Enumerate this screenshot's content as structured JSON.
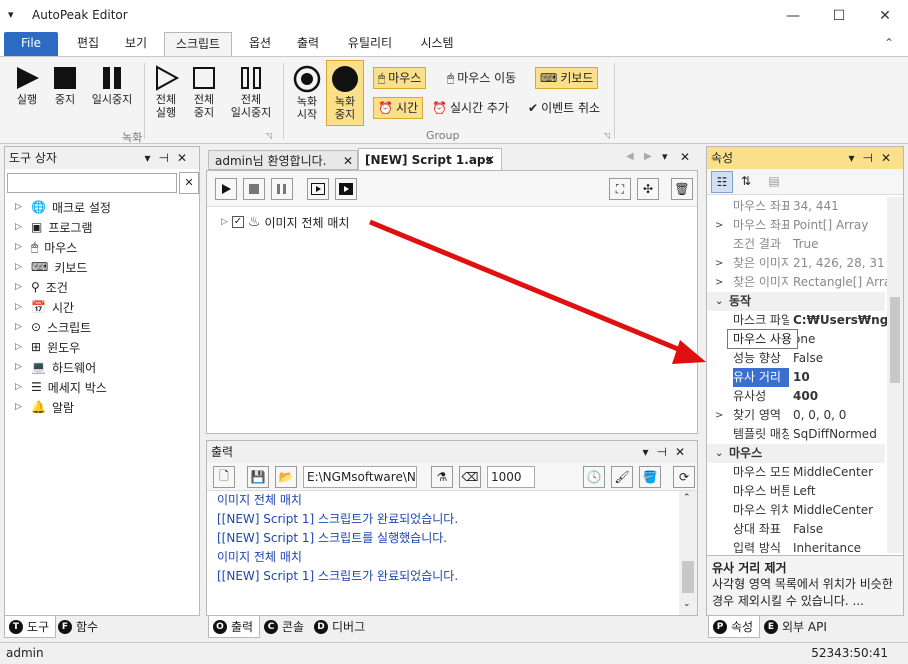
{
  "window": {
    "title": "AutoPeak Editor",
    "menu_icon": "▾",
    "min": "—",
    "max": "☐",
    "close": "✕"
  },
  "menu": {
    "file": "File",
    "tabs": [
      "편집",
      "보기",
      "스크립트",
      "옵션",
      "출력",
      "유틸리티",
      "시스템"
    ],
    "collapse_icon": "chevron-up-icon"
  },
  "ribbon": {
    "run": "실행",
    "stop": "중지",
    "pause": "일시중지",
    "run_all_1": "전체",
    "run_all_2": "실행",
    "stop_all_1": "전체",
    "stop_all_2": "중지",
    "pause_all_1": "전체",
    "pause_all_2": "일시중지",
    "group1": "녹화",
    "rec_start_1": "녹화",
    "rec_start_2": "시작",
    "rec_stop_1": "녹화",
    "rec_stop_2": "중지",
    "mouse": "마우스",
    "mouse_move": "마우스 이동",
    "keyboard": "키보드",
    "time": "시간",
    "realtime_add": "실시간 추가",
    "event_cancel": "이벤트 취소",
    "group2": "Group"
  },
  "toolbox": {
    "title": "도구 상자",
    "search_placeholder": "",
    "clear": "✕",
    "items": [
      "매크로 설정",
      "프로그램",
      "마우스",
      "키보드",
      "조건",
      "시간",
      "스크립트",
      "윈도우",
      "하드웨어",
      "메세지 박스",
      "알람"
    ],
    "tabs": [
      {
        "letter": "T",
        "label": "도구"
      },
      {
        "letter": "F",
        "label": "함수"
      }
    ]
  },
  "editor": {
    "tabs": [
      {
        "label": "admin님 환영합니다.",
        "close": "✕"
      },
      {
        "label": "[NEW] Script 1.aps",
        "close": "✕"
      }
    ],
    "node_label": "이미지 전체 매치",
    "node_expander": "▷",
    "node_check": "✓"
  },
  "output": {
    "title": "출력",
    "path": "E:\\NGMsoftware\\NG",
    "count": "1000",
    "lines": [
      "이미지 전체 매치",
      "[[NEW] Script 1] 스크립트가 완료되었습니다.",
      "[[NEW] Script 1] 스크립트를 실행했습니다.",
      "이미지 전체 매치",
      "[[NEW] Script 1] 스크립트가 완료되었습니다."
    ],
    "tabs": [
      {
        "letter": "O",
        "label": "출력"
      },
      {
        "letter": "C",
        "label": "콘솔"
      },
      {
        "letter": "D",
        "label": "디버그"
      }
    ]
  },
  "properties": {
    "title": "속성",
    "rows": [
      {
        "exp": "",
        "k": "마우스 좌표",
        "v": "34, 441",
        "dim": true
      },
      {
        "exp": ">",
        "k": "마우스 좌표",
        "v": "Point[] Array",
        "dim": true
      },
      {
        "exp": "",
        "k": "조건 결과",
        "v": "True",
        "dim": true
      },
      {
        "exp": ">",
        "k": "찾은 이미지",
        "v": "21, 426, 28, 31",
        "dim": true
      },
      {
        "exp": ">",
        "k": "찾은 이미지",
        "v": "Rectangle[] Array",
        "dim": true
      },
      {
        "cat": true,
        "exp": "⌄",
        "k": "동작"
      },
      {
        "exp": "",
        "k": "마스크 파일",
        "v": "C:₩Users₩ngma",
        "bold": true
      },
      {
        "exp": "",
        "k": "",
        "v": "one"
      },
      {
        "exp": "",
        "k": "성능 향상",
        "v": "False"
      },
      {
        "exp": "",
        "k": "유사 거리",
        "v": "10",
        "bold": true,
        "selected": true
      },
      {
        "exp": "",
        "k": "유사성",
        "v": "400",
        "bold": true
      },
      {
        "exp": ">",
        "k": "찾기 영역",
        "v": "0, 0, 0, 0"
      },
      {
        "exp": "",
        "k": "템플릿 매칭",
        "v": "SqDiffNormed"
      },
      {
        "cat": true,
        "exp": "⌄",
        "k": "마우스"
      },
      {
        "exp": "",
        "k": "마우스 모드",
        "v": "MiddleCenter"
      },
      {
        "exp": "",
        "k": "마우스 버튼",
        "v": "Left"
      },
      {
        "exp": "",
        "k": "마우스 위치",
        "v": "MiddleCenter"
      },
      {
        "exp": "",
        "k": "상대 좌표",
        "v": "False"
      },
      {
        "exp": "",
        "k": "입력 방식",
        "v": "Inheritance"
      }
    ],
    "tooltip": "마우스 사용",
    "desc_title": "유사 거리 제거",
    "desc_text": "사각형 영역 목록에서 위치가 비슷한 경우 제외시킬 수 있습니다. ...",
    "tabs": [
      {
        "letter": "P",
        "label": "속성"
      },
      {
        "letter": "E",
        "label": "외부 API"
      }
    ]
  },
  "status": {
    "user": "admin",
    "time": "52343:50:41"
  },
  "colors": {
    "accent": "#2c6bc4",
    "ribbon_highlight": "#fbe08c",
    "selection": "#3a6fcf",
    "arrow": "#e01010",
    "output_text": "#1d45b3"
  }
}
